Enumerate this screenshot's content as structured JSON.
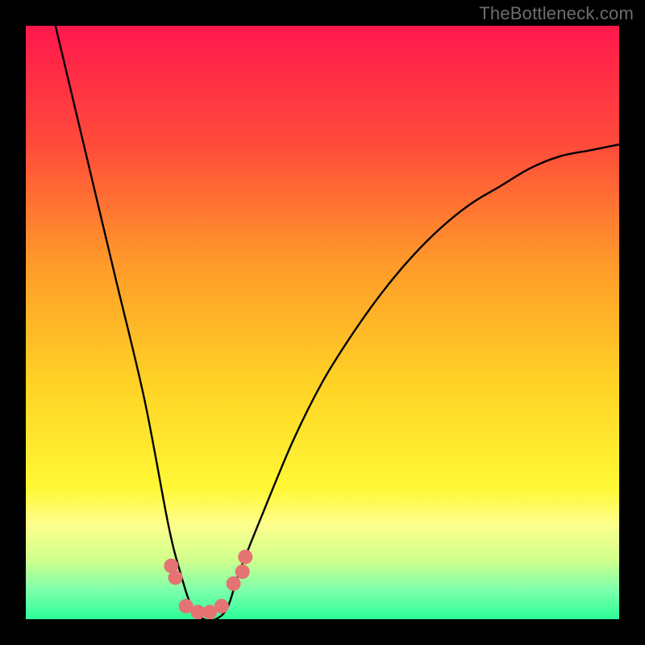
{
  "watermark": "TheBottleneck.com",
  "chart_data": {
    "type": "line",
    "title": "",
    "xlabel": "",
    "ylabel": "",
    "xlim": [
      0,
      100
    ],
    "ylim": [
      0,
      100
    ],
    "series": [
      {
        "name": "bottleneck-curve",
        "x": [
          5,
          10,
          15,
          20,
          24,
          26,
          28,
          30,
          32,
          34,
          36,
          40,
          45,
          50,
          55,
          60,
          65,
          70,
          75,
          80,
          85,
          90,
          95,
          100
        ],
        "y": [
          100,
          79,
          58,
          37,
          16,
          8,
          2,
          0,
          0,
          2,
          8,
          18,
          30,
          40,
          48,
          55,
          61,
          66,
          70,
          73,
          76,
          78,
          79,
          80
        ]
      }
    ],
    "markers": {
      "name": "highlight-points",
      "color": "#e57373",
      "x": [
        24.5,
        25.2,
        27,
        29,
        31,
        33,
        35,
        36.5,
        37
      ],
      "y": [
        9,
        7,
        2.2,
        1.2,
        1.2,
        2.2,
        6,
        8,
        10.5
      ]
    },
    "background_gradient": {
      "stops": [
        {
          "offset": 0.0,
          "color": "#ff184d"
        },
        {
          "offset": 0.2,
          "color": "#ff4b3a"
        },
        {
          "offset": 0.4,
          "color": "#ff9a2a"
        },
        {
          "offset": 0.6,
          "color": "#ffd225"
        },
        {
          "offset": 0.78,
          "color": "#fff835"
        },
        {
          "offset": 0.84,
          "color": "#fdff8c"
        },
        {
          "offset": 0.9,
          "color": "#d0ff8c"
        },
        {
          "offset": 0.95,
          "color": "#7fffab"
        },
        {
          "offset": 1.0,
          "color": "#2cff98"
        }
      ]
    }
  }
}
